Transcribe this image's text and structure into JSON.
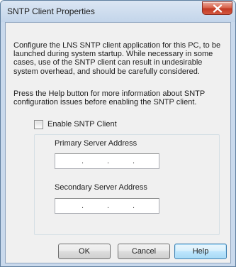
{
  "window": {
    "title": "SNTP Client Properties",
    "close_icon": "close-icon"
  },
  "description": {
    "paragraph1": "Configure the LNS SNTP client application for this PC, to be launched during system startup.  While necessary in some cases, use of the SNTP client can result in undesirable system overhead, and should be carefully considered.",
    "paragraph2": "Press the Help button for more information about SNTP configuration issues before enabling the SNTP client."
  },
  "enable_checkbox": {
    "label": "Enable SNTP Client",
    "checked": false
  },
  "primary": {
    "label": "Primary Server Address",
    "value": ""
  },
  "secondary": {
    "label": "Secondary Server Address",
    "value": ""
  },
  "buttons": {
    "ok": "OK",
    "cancel": "Cancel",
    "help": "Help"
  }
}
